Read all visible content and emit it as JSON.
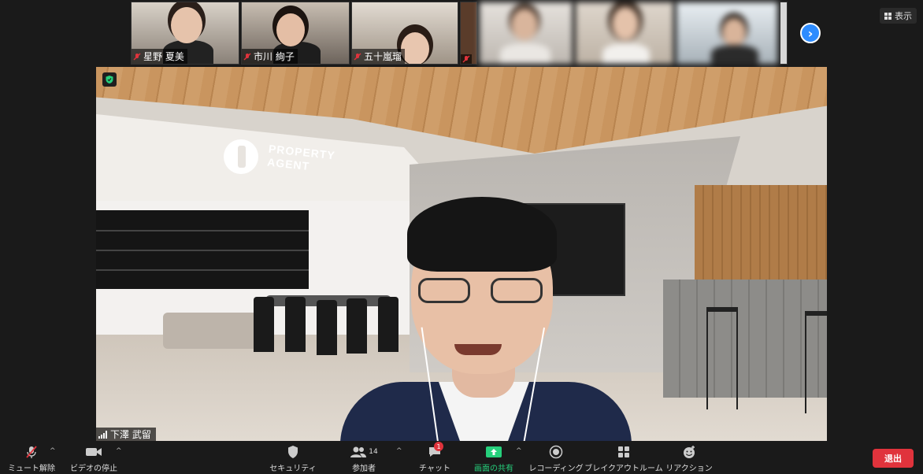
{
  "thumbnails": [
    {
      "name": "星野 夏美",
      "muted": true
    },
    {
      "name": "市川 絢子",
      "muted": true
    },
    {
      "name": "五十嵐瑠",
      "muted": true
    }
  ],
  "view_button": {
    "label": "表示",
    "icon": "grid-icon"
  },
  "next_page_icon": "chevron-right-icon",
  "main_video": {
    "speaker_name": "下澤 武留",
    "sign_text_line1": "PROPERTY",
    "sign_text_line2": "AGENT"
  },
  "toolbar": {
    "mute": {
      "label": "ミュート解除",
      "icon": "mic-off-icon"
    },
    "video": {
      "label": "ビデオの停止",
      "icon": "video-camera-icon"
    },
    "security": {
      "label": "セキュリティ",
      "icon": "shield-icon"
    },
    "participants": {
      "label": "参加者",
      "count": "14",
      "icon": "participants-icon"
    },
    "chat": {
      "label": "チャット",
      "badge": "1",
      "icon": "chat-icon"
    },
    "share": {
      "label": "画面の共有",
      "icon": "share-screen-icon"
    },
    "record": {
      "label": "レコーディング",
      "icon": "record-icon"
    },
    "breakout": {
      "label": "ブレイクアウトルーム",
      "icon": "breakout-icon"
    },
    "reactions": {
      "label": "リアクション",
      "icon": "reaction-icon"
    },
    "leave": {
      "label": "退出"
    }
  },
  "colors": {
    "accent_blue": "#2d8cff",
    "leave_red": "#e0333c",
    "share_green": "#26d07c",
    "background": "#1a1a1a"
  }
}
